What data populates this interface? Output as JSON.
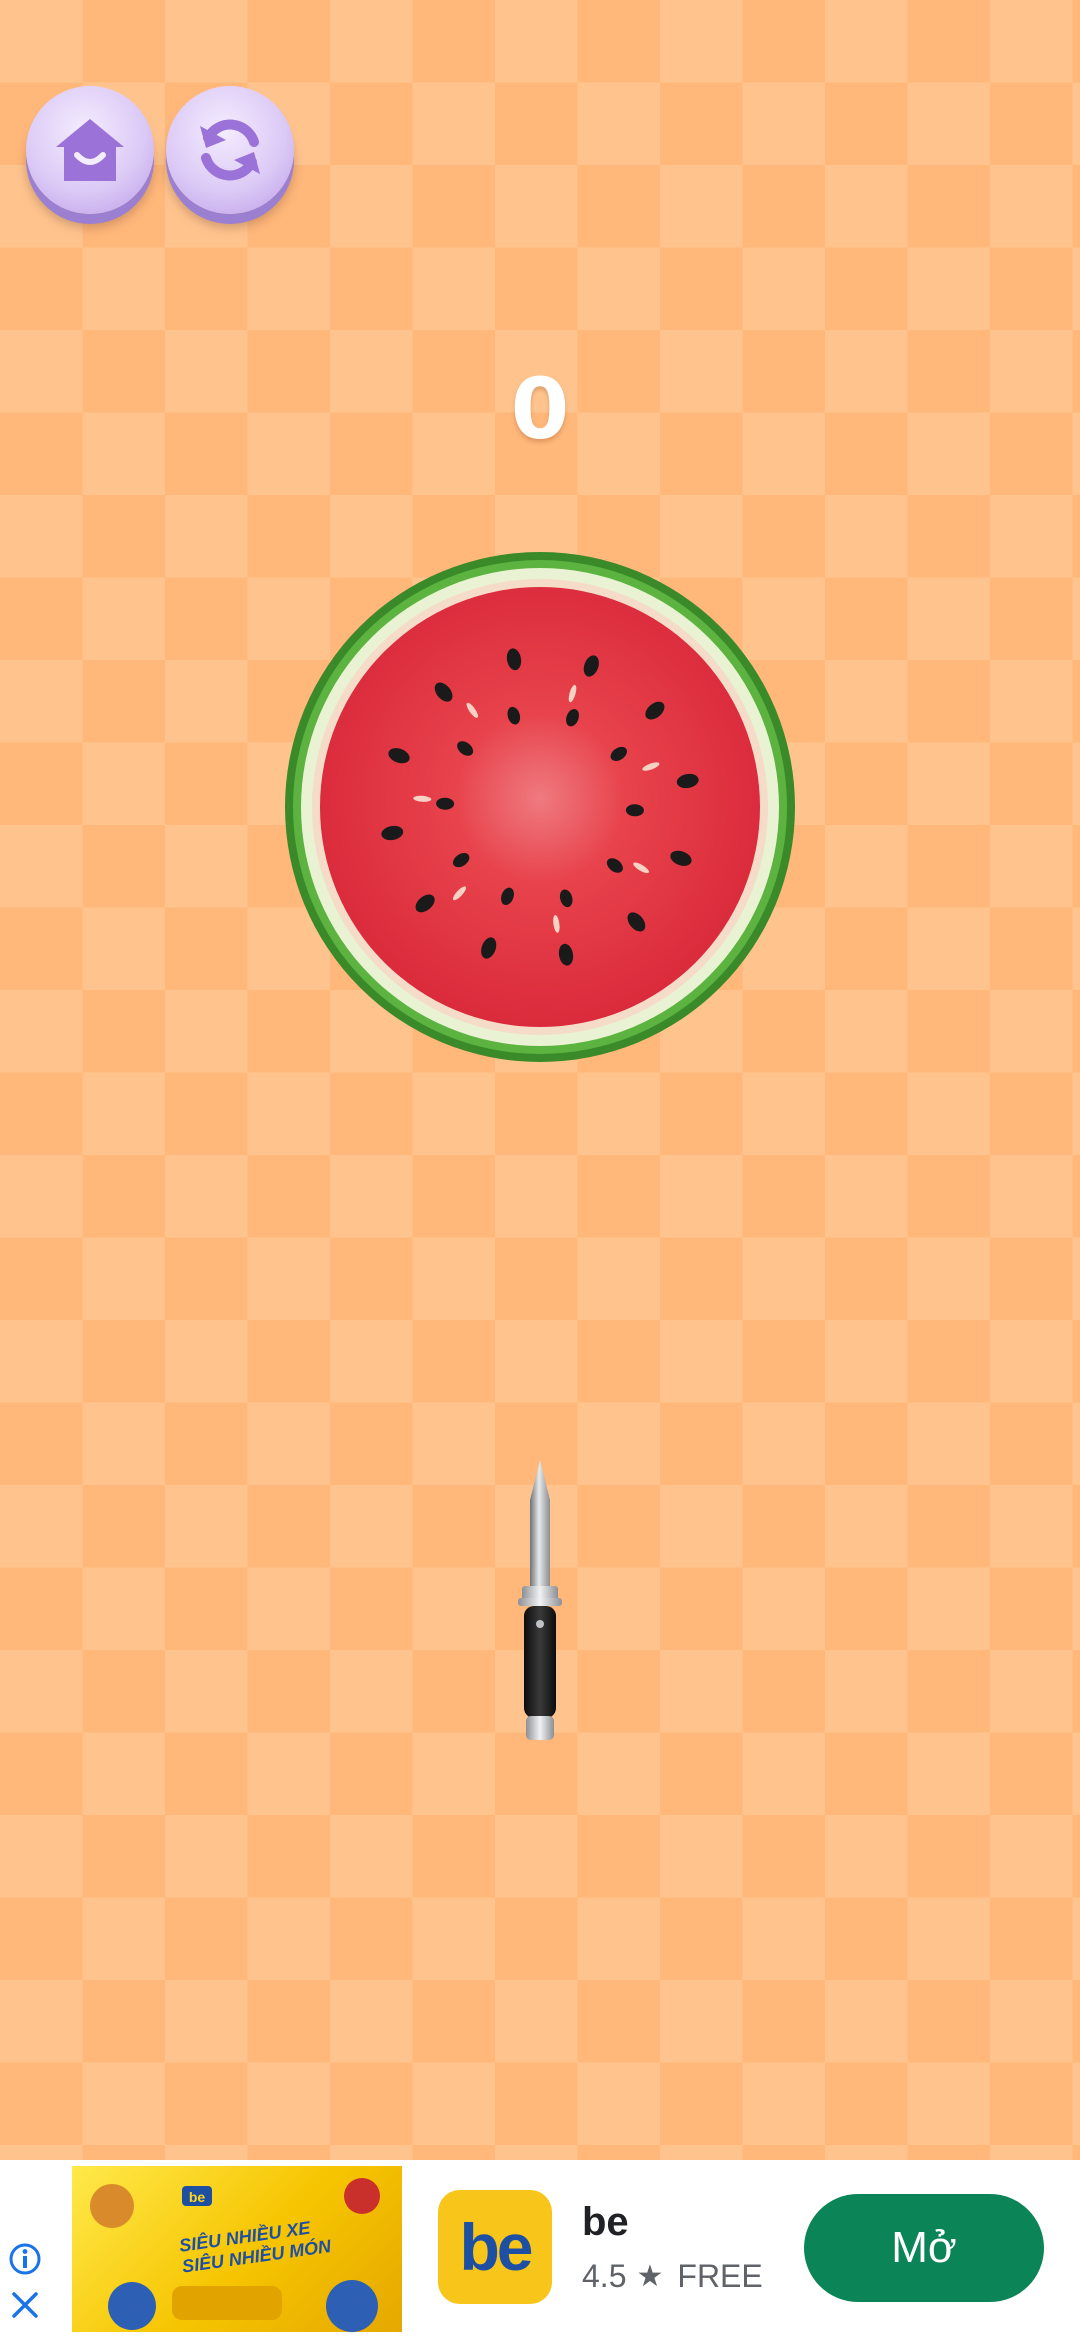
{
  "game": {
    "score": "0",
    "buttons": {
      "home_icon": "home-icon",
      "restart_icon": "refresh-icon"
    },
    "colors": {
      "checker_light": "#ffc48e",
      "checker_dark": "#ffb77a",
      "button_purple": "#dccaf6",
      "melon_flesh": "#e2323c",
      "melon_rind": "#3f9a2e"
    }
  },
  "ad": {
    "app_name": "be",
    "logo_text": "be",
    "rating": "4.5",
    "price": "FREE",
    "cta": "Mở",
    "banner_lines": [
      "SIÊU NHIỀU XE",
      "SIÊU NHIỀU MÓN"
    ],
    "info_icon": "info-icon",
    "close_icon": "close-icon"
  }
}
